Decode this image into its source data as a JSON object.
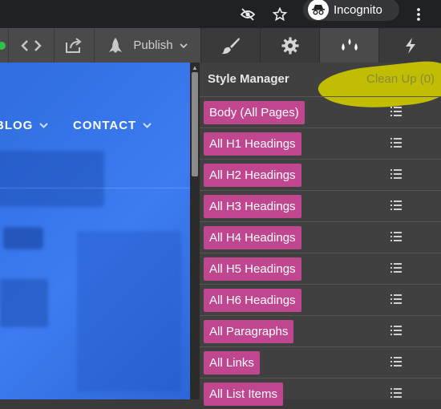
{
  "browser": {
    "incognito_label": "Incognito"
  },
  "toolbar": {
    "publish_label": "Publish"
  },
  "site_nav": {
    "items": [
      {
        "label": "BLOG"
      },
      {
        "label": "CONTACT"
      }
    ]
  },
  "panel": {
    "title": "Style Manager",
    "cleanup_label": "Clean Up (0)",
    "styles": [
      {
        "label": "Body (All Pages)"
      },
      {
        "label": "All H1 Headings"
      },
      {
        "label": "All H2 Headings"
      },
      {
        "label": "All H3 Headings"
      },
      {
        "label": "All H4 Headings"
      },
      {
        "label": "All H5 Headings"
      },
      {
        "label": "All H6 Headings"
      },
      {
        "label": "All Paragraphs"
      },
      {
        "label": "All Links"
      },
      {
        "label": "All List Items"
      }
    ]
  },
  "colors": {
    "style_tag": "#c0468f",
    "highlight": "#c8c400",
    "canvas_blue": "#2f6de0",
    "panel_bg": "#404040"
  }
}
